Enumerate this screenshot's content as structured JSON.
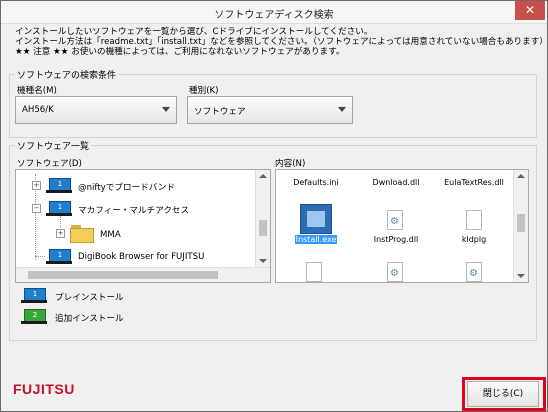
{
  "window": {
    "title": "ソフトウェアディスク検索",
    "close_glyph": "✕"
  },
  "intro": {
    "line1": "インストールしたいソフトウェアを一覧から選び、Cドライブにインストールしてください。",
    "line2": "インストール方法は「readme.txt」「install.txt」などを参照してください。（ソフトウェアによっては用意されていない場合もあります）",
    "line3": "★★ 注意 ★★ お使いの機種によっては、ご利用になれないソフトウェアがあります。"
  },
  "search": {
    "group_label": "ソフトウェアの検索条件",
    "model_label": "機種名(M)",
    "model_value": "AH56/K",
    "type_label": "種別(K)",
    "type_value": "ソフトウェア"
  },
  "list": {
    "group_label": "ソフトウェア一覧",
    "software_label": "ソフトウェア(D)",
    "content_label": "内容(N)",
    "tree": [
      {
        "label": "@niftyでブロードバンド",
        "badge": "1"
      },
      {
        "label": "マカフィー・マルチアクセス",
        "badge": "1"
      },
      {
        "label": "MMA"
      },
      {
        "label": "DigiBook Browser for FUJITSU",
        "badge": "1"
      }
    ],
    "files_row1": [
      "Defaults.ini",
      "Dwnload.dll",
      "EulaTextRes.dll"
    ],
    "files_row2": [
      "Install.exe",
      "InstProg.dll",
      "kldplg"
    ]
  },
  "legend": {
    "preinstall_badge": "1",
    "preinstall": "プレインストール",
    "addinstall_badge": "2",
    "addinstall": "追加インストール"
  },
  "footer": {
    "brand": "FUJITSU",
    "close_button": "閉じる(C)"
  },
  "colors": {
    "highlight": "#e1001d",
    "selection": "#3399ff",
    "brand": "#c8102e"
  }
}
